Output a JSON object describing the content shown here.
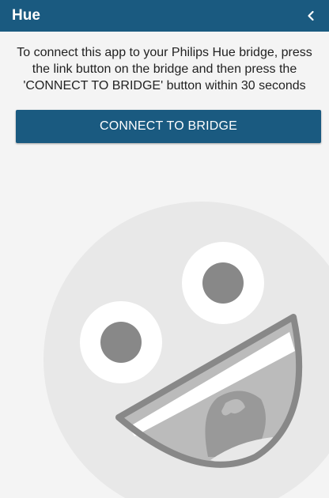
{
  "app_bar": {
    "title": "Hue",
    "back_icon": "chevron-left-icon"
  },
  "instructions": {
    "line1": "To connect this app to your Philips Hue bridge, press",
    "line2": "the link button on the bridge and then press the",
    "line3": "'CONNECT TO BRIDGE' button within 30 seconds"
  },
  "connect_button": {
    "label": "CONNECT TO BRIDGE"
  },
  "illustration": {
    "icon": "laughing-face-icon"
  },
  "colors": {
    "primary": "#1a5a80",
    "background": "#f4f4f4",
    "face": "#e8e8e8",
    "features": "#888888",
    "mouth_fill": "#bbbbbb"
  }
}
